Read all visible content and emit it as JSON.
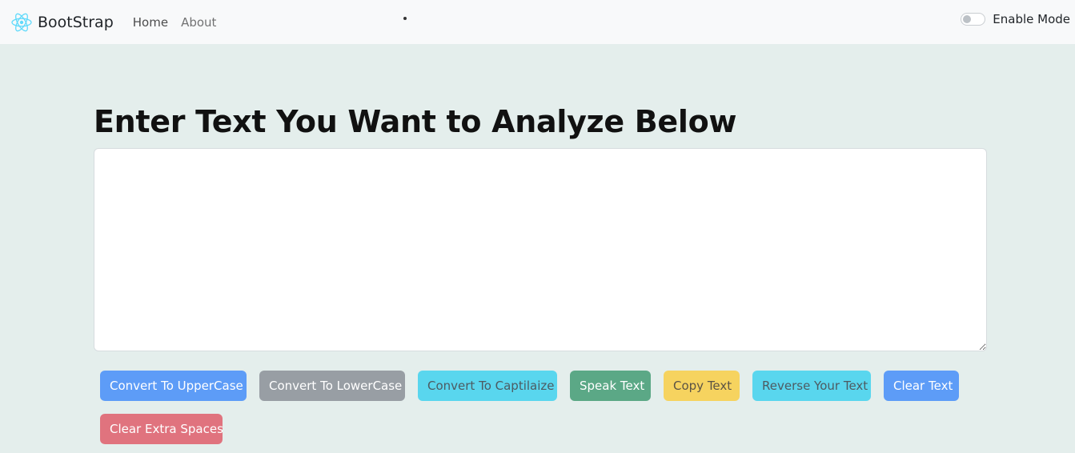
{
  "navbar": {
    "brand": "BootStrap",
    "links": [
      "Home",
      "About"
    ],
    "mode_label": "Enable Mode",
    "mode_enabled": false
  },
  "main": {
    "heading": "Enter Text You Want to Analyze Below",
    "textarea_value": ""
  },
  "buttons": {
    "uppercase": "Convert To UpperCase",
    "lowercase": "Convert To LowerCase",
    "capitalize": "Convert To Captilaize",
    "speak": "Speak Text",
    "copy": "Copy Text",
    "reverse": "Reverse Your Text",
    "clear": "Clear Text",
    "clear_spaces": "Clear Extra Spaces"
  },
  "colors": {
    "primary": "#5d9cf7",
    "secondary": "#989ea4",
    "info": "#59d6ee",
    "success": "#5ba886",
    "warning": "#f6d35f",
    "danger": "#e0737e",
    "background": "#e4eeec"
  },
  "icons": {
    "brand": "react-atom-icon"
  }
}
